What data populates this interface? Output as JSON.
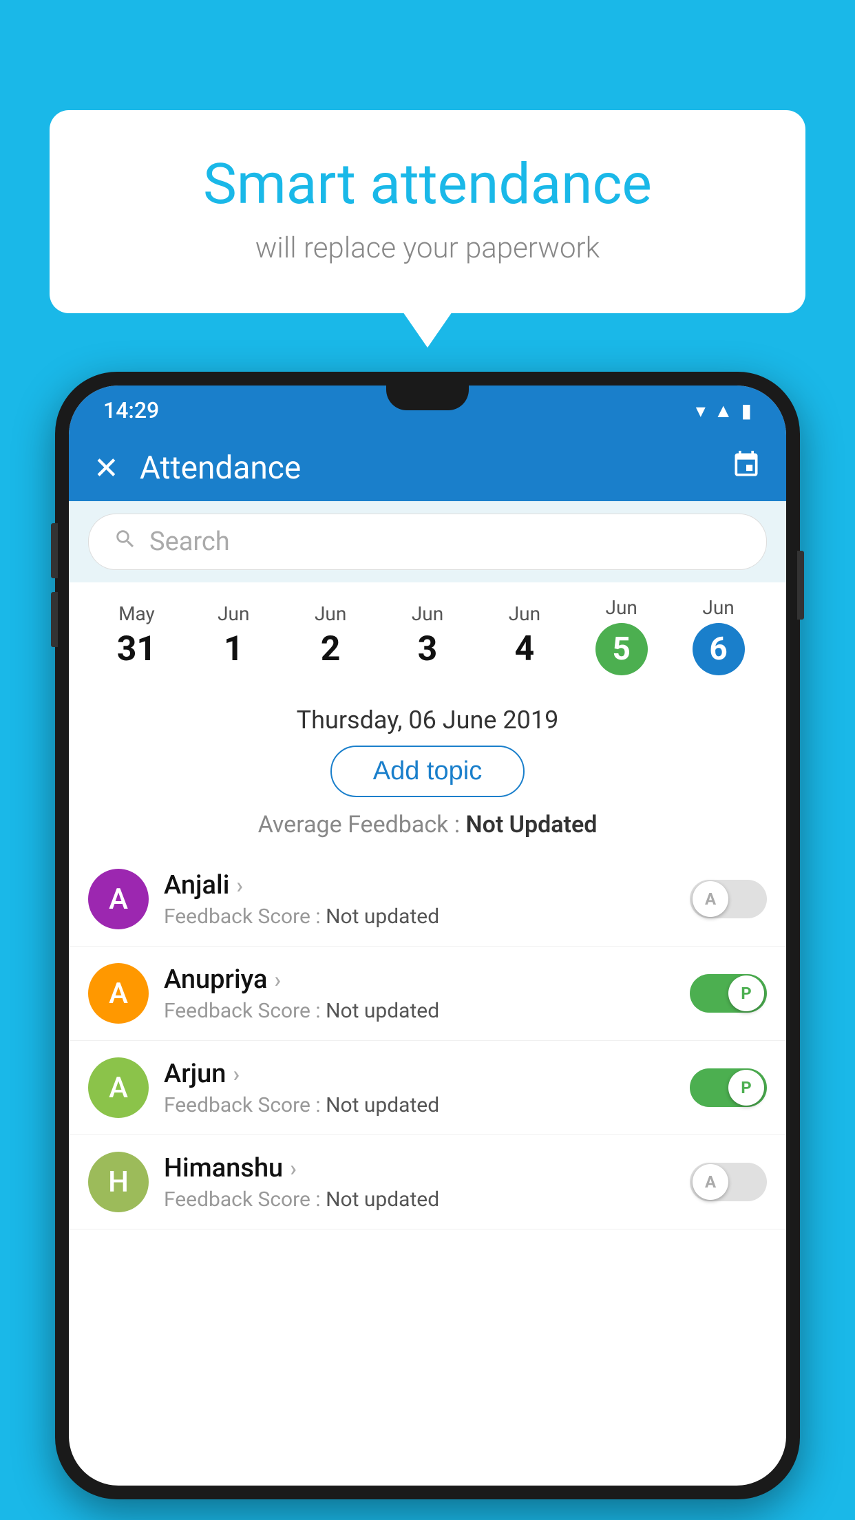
{
  "background_color": "#1ab8e8",
  "speech_bubble": {
    "title": "Smart attendance",
    "subtitle": "will replace your paperwork"
  },
  "status_bar": {
    "time": "14:29"
  },
  "app_bar": {
    "title": "Attendance",
    "close_label": "✕",
    "calendar_icon": "📅"
  },
  "search": {
    "placeholder": "Search"
  },
  "dates": [
    {
      "month": "May",
      "day": "31",
      "style": "normal"
    },
    {
      "month": "Jun",
      "day": "1",
      "style": "normal"
    },
    {
      "month": "Jun",
      "day": "2",
      "style": "normal"
    },
    {
      "month": "Jun",
      "day": "3",
      "style": "normal"
    },
    {
      "month": "Jun",
      "day": "4",
      "style": "normal"
    },
    {
      "month": "Jun",
      "day": "5",
      "style": "green"
    },
    {
      "month": "Jun",
      "day": "6",
      "style": "blue"
    }
  ],
  "selected_date_label": "Thursday, 06 June 2019",
  "add_topic_label": "Add topic",
  "avg_feedback_label": "Average Feedback : ",
  "avg_feedback_value": "Not Updated",
  "students": [
    {
      "name": "Anjali",
      "avatar_letter": "A",
      "avatar_color": "purple",
      "feedback_label": "Feedback Score : ",
      "feedback_value": "Not updated",
      "toggle": "off",
      "toggle_letter": "A"
    },
    {
      "name": "Anupriya",
      "avatar_letter": "A",
      "avatar_color": "orange",
      "feedback_label": "Feedback Score : ",
      "feedback_value": "Not updated",
      "toggle": "on",
      "toggle_letter": "P"
    },
    {
      "name": "Arjun",
      "avatar_letter": "A",
      "avatar_color": "green",
      "feedback_label": "Feedback Score : ",
      "feedback_value": "Not updated",
      "toggle": "on",
      "toggle_letter": "P"
    },
    {
      "name": "Himanshu",
      "avatar_letter": "H",
      "avatar_color": "olive",
      "feedback_label": "Feedback Score : ",
      "feedback_value": "Not updated",
      "toggle": "off",
      "toggle_letter": "A"
    }
  ]
}
